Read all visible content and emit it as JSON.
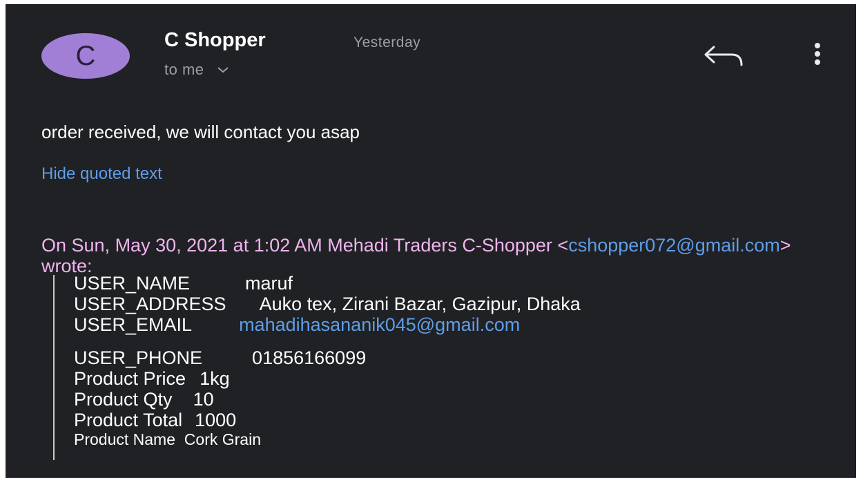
{
  "header": {
    "avatar_letter": "C",
    "sender": "C Shopper",
    "time": "Yesterday",
    "to": "to me"
  },
  "message": {
    "body": "order received, we will contact you asap",
    "hide_quoted": "Hide quoted text"
  },
  "quote": {
    "intro_before": "On Sun, May 30, 2021 at 1:02 AM Mehadi Traders C-Shopper <",
    "email": "cshopper072@gmail.com",
    "intro_after": "> wrote:",
    "user_name_label": "USER_NAME",
    "user_name": "maruf",
    "user_address_label": "USER_ADDRESS",
    "user_address": "Auko tex, Zirani Bazar, Gazipur, Dhaka",
    "user_email_label": "USER_EMAIL",
    "user_email": "mahadihasananik045@gmail.com",
    "user_phone_label": "USER_PHONE",
    "user_phone": "01856166099",
    "price_label": "Product Price",
    "price": "1kg",
    "qty_label": "Product Qty",
    "qty": "10",
    "total_label": "Product Total",
    "total": "1000",
    "name_label": "Product Name",
    "name": "Cork Grain"
  },
  "icons": {
    "reply": "reply-icon",
    "more": "more-vert-icon",
    "chevron": "chevron-down-icon"
  },
  "colors": {
    "background": "#202124",
    "avatar": "#a27fd6",
    "link": "#5f9de8",
    "quote_header": "#f0b4f0",
    "muted": "#9aa0a6"
  }
}
